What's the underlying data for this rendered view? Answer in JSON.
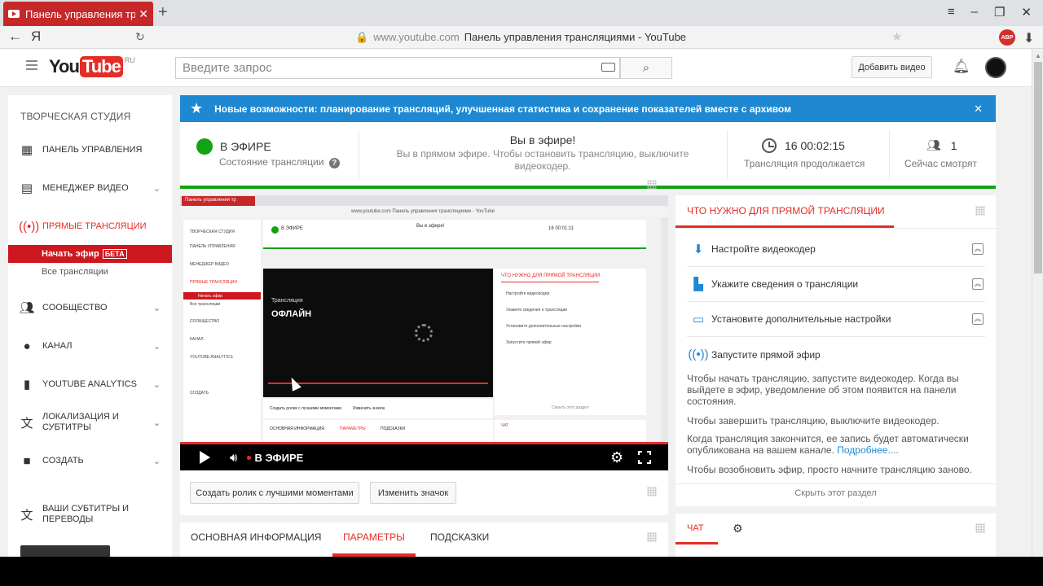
{
  "browser": {
    "tab_title": "Панель управления тра",
    "url_domain": "www.youtube.com",
    "url_title": "Панель управления трансляциями - YouTube",
    "ya": "Я",
    "abp": "ABP"
  },
  "header": {
    "search_placeholder": "Введите запрос",
    "add_video": "Добавить видео",
    "logo_you": "You",
    "logo_tube": "Tube",
    "logo_region": "RU"
  },
  "sidebar": {
    "title": "ТВОРЧЕСКАЯ СТУДИЯ",
    "items": [
      {
        "label": "ПАНЕЛЬ УПРАВЛЕНИЯ",
        "icon": "dashboard-icon"
      },
      {
        "label": "МЕНЕДЖЕР ВИДЕО",
        "icon": "video-manager-icon"
      },
      {
        "label": "ПРЯМЫЕ ТРАНСЛЯЦИИ",
        "icon": "live-icon"
      },
      {
        "label": "СООБЩЕСТВО",
        "icon": "community-icon"
      },
      {
        "label": "КАНАЛ",
        "icon": "channel-icon"
      },
      {
        "label": "YOUTUBE ANALYTICS",
        "icon": "analytics-icon"
      },
      {
        "label": "ЛОКАЛИЗАЦИЯ И СУБТИТРЫ",
        "icon": "translate-icon"
      },
      {
        "label": "СОЗДАТЬ",
        "icon": "camera-icon"
      },
      {
        "label": "ВАШИ СУБТИТРЫ И ПЕРЕВОДЫ",
        "icon": "translate-icon"
      }
    ],
    "sub_start": "Начать эфир",
    "sub_beta": "БЕТА",
    "sub_all": "Все трансляции"
  },
  "banner": {
    "text": "Новые возможности: планирование трансляций, улучшенная статистика и сохранение показателей вместе с архивом"
  },
  "status": {
    "live_label": "В ЭФИРЕ",
    "state_label": "Состояние трансляции",
    "center_title": "Вы в эфире!",
    "center_sub": "Вы в прямом эфире. Чтобы остановить трансляцию, выключите видеокодер.",
    "duration": "16 00:02:15",
    "duration_label": "Трансляция продолжается",
    "viewers": "1",
    "viewers_label": "Сейчас смотрят"
  },
  "preview": {
    "broadcast": "Трансляция",
    "offline": "ОФЛАЙН",
    "mini_tab": "Панель управления тр",
    "mini_url": "www.youtube.com   Панель управления трансляциями - YouTube",
    "mini_sidebar_title": "ТВОРЧЕСКАЯ СТУДИЯ",
    "mini_dashboard": "ПАНЕЛЬ УПРАВЛЕНИЯ",
    "mini_video_manager": "МЕНЕДЖЕР ВИДЕО",
    "mini_live": "ПРЯМЫЕ ТРАНСЛЯЦИИ",
    "mini_start": "Начать эфир",
    "mini_all": "Все трансляции",
    "mini_community": "СООБЩЕСТВО",
    "mini_channel": "КАНАЛ",
    "mini_analytics": "YOUTUBE ANALYTICS",
    "mini_create": "СОЗДАТЬ",
    "mini_live_label": "В ЭФИРЕ",
    "mini_center": "Вы в эфире!",
    "mini_time": "16 00:01:11",
    "mini_right_head": "ЧТО НУЖНО ДЛЯ ПРЯМОЙ ТРАНСЛЯЦИИ",
    "mini_step1": "Настройте видеокодер",
    "mini_step2": "Укажите сведения о трансляции",
    "mini_step3": "Установите дополнительные настройки",
    "mini_step4": "Запустите прямой эфир",
    "mini_hide": "Скрыть этот раздел",
    "mini_tab1": "ОСНОВНАЯ ИНФОРМАЦИЯ",
    "mini_tab2": "ПАРАМЕТРЫ",
    "mini_tab3": "ПОДСКАЗКИ",
    "mini_chat": "ЧАТ",
    "mini_btn1": "Создать ролик с лучшими моментами",
    "mini_btn2": "Изменить значок"
  },
  "player": {
    "live_label": "В ЭФИРЕ"
  },
  "actions": {
    "highlights": "Создать ролик с лучшими моментами",
    "change_thumb": "Изменить значок"
  },
  "tabs": {
    "basic": "ОСНОВНАЯ ИНФОРМАЦИЯ",
    "params": "ПАРАМЕТРЫ",
    "tips": "ПОДСКАЗКИ"
  },
  "right": {
    "heading": "ЧТО НУЖНО ДЛЯ ПРЯМОЙ ТРАНСЛЯЦИИ",
    "steps": [
      "Настройте видеокодер",
      "Укажите сведения о трансляции",
      "Установите дополнительные настройки",
      "Запустите прямой эфир"
    ],
    "p1": "Чтобы начать трансляцию, запустите видеокодер. Когда вы выйдете в эфир, уведомление об этом появится на панели состояния.",
    "p2": "Чтобы завершить трансляцию, выключите видеокодер.",
    "p3": "Когда трансляция закончится, ее запись будет автоматически опубликована на вашем канале.",
    "p3_link": "Подробнее....",
    "p4": "Чтобы возобновить эфир, просто начните трансляцию заново.",
    "hide": "Скрыть этот раздел"
  },
  "chat": {
    "label": "ЧАТ"
  },
  "colors": {
    "brand_red": "#e52d27",
    "live_green": "#12a312",
    "banner_blue": "#1e88d2"
  }
}
